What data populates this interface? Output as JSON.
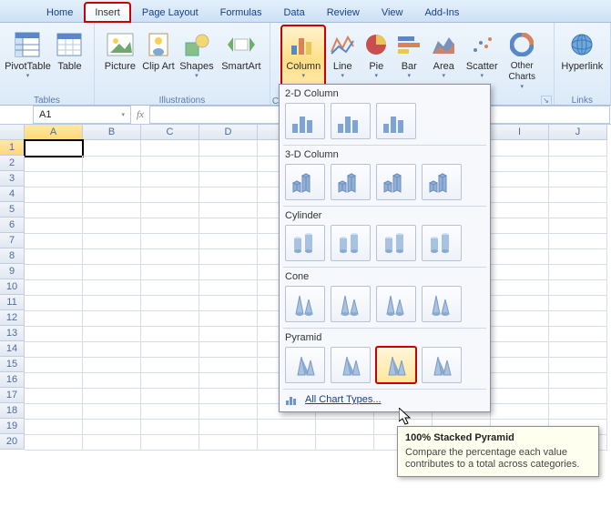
{
  "tabs": [
    "Home",
    "Insert",
    "Page Layout",
    "Formulas",
    "Data",
    "Review",
    "View",
    "Add-Ins"
  ],
  "active_tab": 1,
  "ribbon": {
    "tables": {
      "label": "Tables",
      "items": [
        "PivotTable",
        "Table"
      ]
    },
    "illustrations": {
      "label": "Illustrations",
      "items": [
        "Picture",
        "Clip Art",
        "Shapes",
        "SmartArt"
      ]
    },
    "charts": {
      "label": "Charts",
      "items": [
        "Column",
        "Line",
        "Pie",
        "Bar",
        "Area",
        "Scatter",
        "Other Charts"
      ]
    },
    "links": {
      "label": "Links",
      "items": [
        "Hyperlink"
      ]
    }
  },
  "namebox": "A1",
  "fx_label": "fx",
  "columns": [
    "A",
    "B",
    "C",
    "D",
    "",
    "",
    "",
    "",
    "I",
    "J"
  ],
  "rows_shown": 20,
  "active_cell": "A1",
  "column_dropdown": {
    "sections": [
      {
        "title": "2-D Column",
        "count": 3
      },
      {
        "title": "3-D Column",
        "count": 4
      },
      {
        "title": "Cylinder",
        "count": 4
      },
      {
        "title": "Cone",
        "count": 4
      },
      {
        "title": "Pyramid",
        "count": 4
      }
    ],
    "footer": "All Chart Types...",
    "hover_section": 4,
    "hover_index": 2
  },
  "tooltip": {
    "title": "100% Stacked Pyramid",
    "body": "Compare the percentage each value contributes to a total across categories."
  },
  "chart_data": {
    "type": "table",
    "categories": [],
    "values": [],
    "title": "",
    "xlabel": "",
    "ylabel": ""
  }
}
